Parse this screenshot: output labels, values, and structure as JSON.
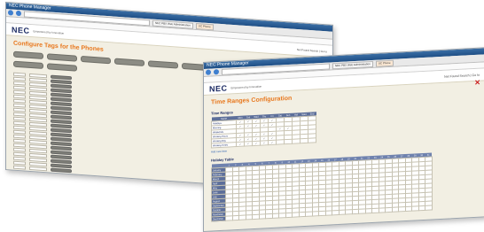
{
  "window1": {
    "title": "NEC Phone Manager",
    "tabs": [
      "NEC PBX Web Administration",
      "UC Phone"
    ],
    "brand": "NEC",
    "brand_sub": "Empowered by Innovation",
    "header_right": "Net Found Search | Go to",
    "page_title": "Configure Tags for the Phones",
    "pill_count": 11,
    "rows": 24
  },
  "window2": {
    "title": "NEC Phone Manager",
    "tabs": [
      "NEC PBX Web Administration",
      "UC Phone"
    ],
    "brand": "NEC",
    "brand_sub": "Empowered by Innovation",
    "header_right": "Net Found Search | Go to",
    "page_title": "Time Ranges Configuration",
    "section_time_ranges": "Time Ranges",
    "time_ranges_header": {
      "name": "Name",
      "days": [
        "Mon",
        "Tue",
        "Wed",
        "Thu",
        "Fri",
        "Sat",
        "Sun",
        "Hol",
        "Start",
        "End"
      ]
    },
    "time_ranges": [
      {
        "name": "Holidays",
        "checks": [
          true,
          true,
          true,
          true,
          true,
          false,
          false,
          false
        ]
      },
      {
        "name": "Morning",
        "checks": [
          true,
          true,
          true,
          true,
          true,
          false,
          false,
          false
        ]
      },
      {
        "name": "Weekends",
        "checks": [
          false,
          false,
          false,
          false,
          false,
          true,
          true,
          false
        ]
      },
      {
        "name": "Working Hours",
        "checks": [
          true,
          true,
          true,
          true,
          true,
          false,
          false,
          false
        ]
      },
      {
        "name": "Working Day",
        "checks": [
          true,
          true,
          true,
          true,
          true,
          false,
          false,
          false
        ]
      },
      {
        "name": "Working Times",
        "checks": [
          true,
          true,
          true,
          true,
          true,
          false,
          false,
          false
        ]
      }
    ],
    "add_new": "Add new item",
    "section_holiday": "Holiday Table",
    "months": [
      "January",
      "February",
      "March",
      "April",
      "May",
      "June",
      "July",
      "August",
      "September",
      "October",
      "November",
      "December"
    ],
    "day_count": 31
  },
  "colors": {
    "accent_orange": "#e8781e",
    "nec_blue": "#1b2a63",
    "table_header": "#5d6f9a",
    "page_bg": "#f2efe3"
  }
}
